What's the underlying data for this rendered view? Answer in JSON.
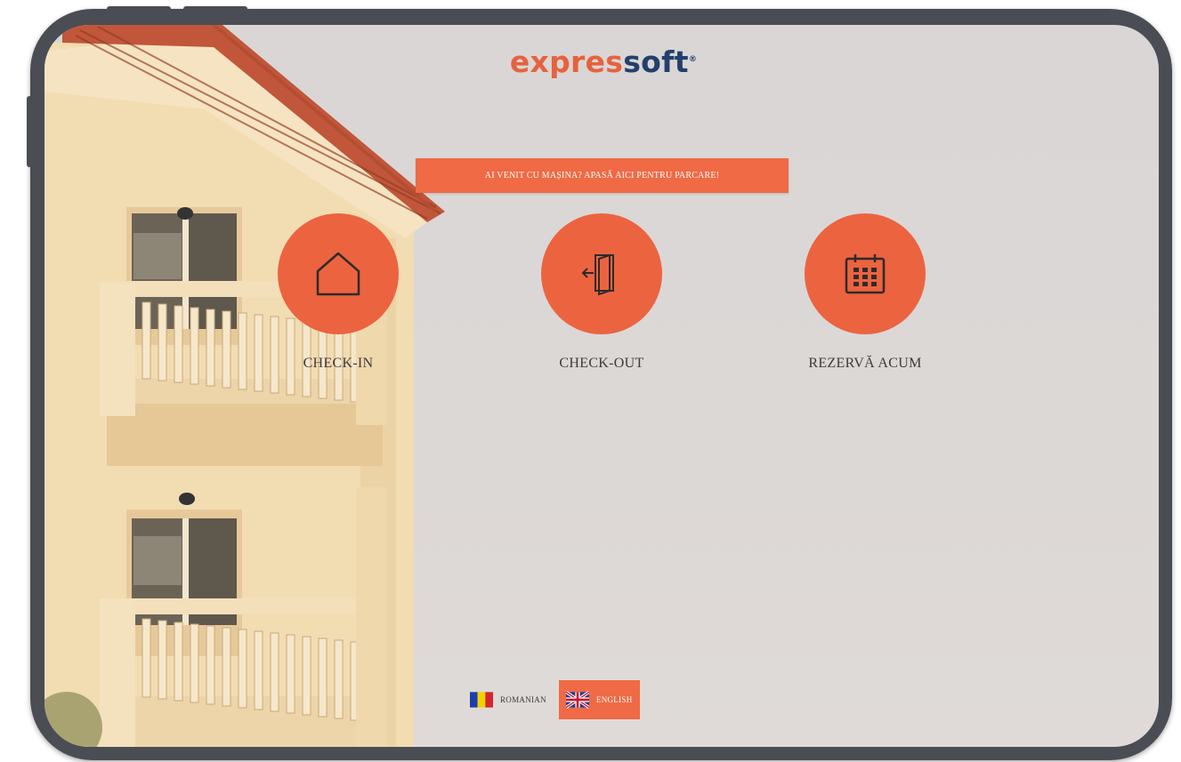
{
  "brand": {
    "part1": "expres",
    "part2": "soft",
    "mark": "®",
    "accent_color": "#e6623e",
    "dark_color": "#23406b"
  },
  "banner": {
    "label": "AI VENIT CU MAȘINA? APASĂ AICI PENTRU PARCARE!"
  },
  "actions": [
    {
      "label": "CHECK-IN",
      "icon": "house-icon"
    },
    {
      "label": "CHECK-OUT",
      "icon": "door-exit-icon"
    },
    {
      "label": "REZERVĂ ACUM",
      "icon": "calendar-icon"
    }
  ],
  "languages": [
    {
      "label": "ROMANIAN",
      "flag": "romania-flag-icon",
      "active": false
    },
    {
      "label": "ENGLISH",
      "flag": "uk-flag-icon",
      "active": true
    }
  ],
  "colors": {
    "primary": "#ec6340",
    "frame": "#4a4d53"
  }
}
